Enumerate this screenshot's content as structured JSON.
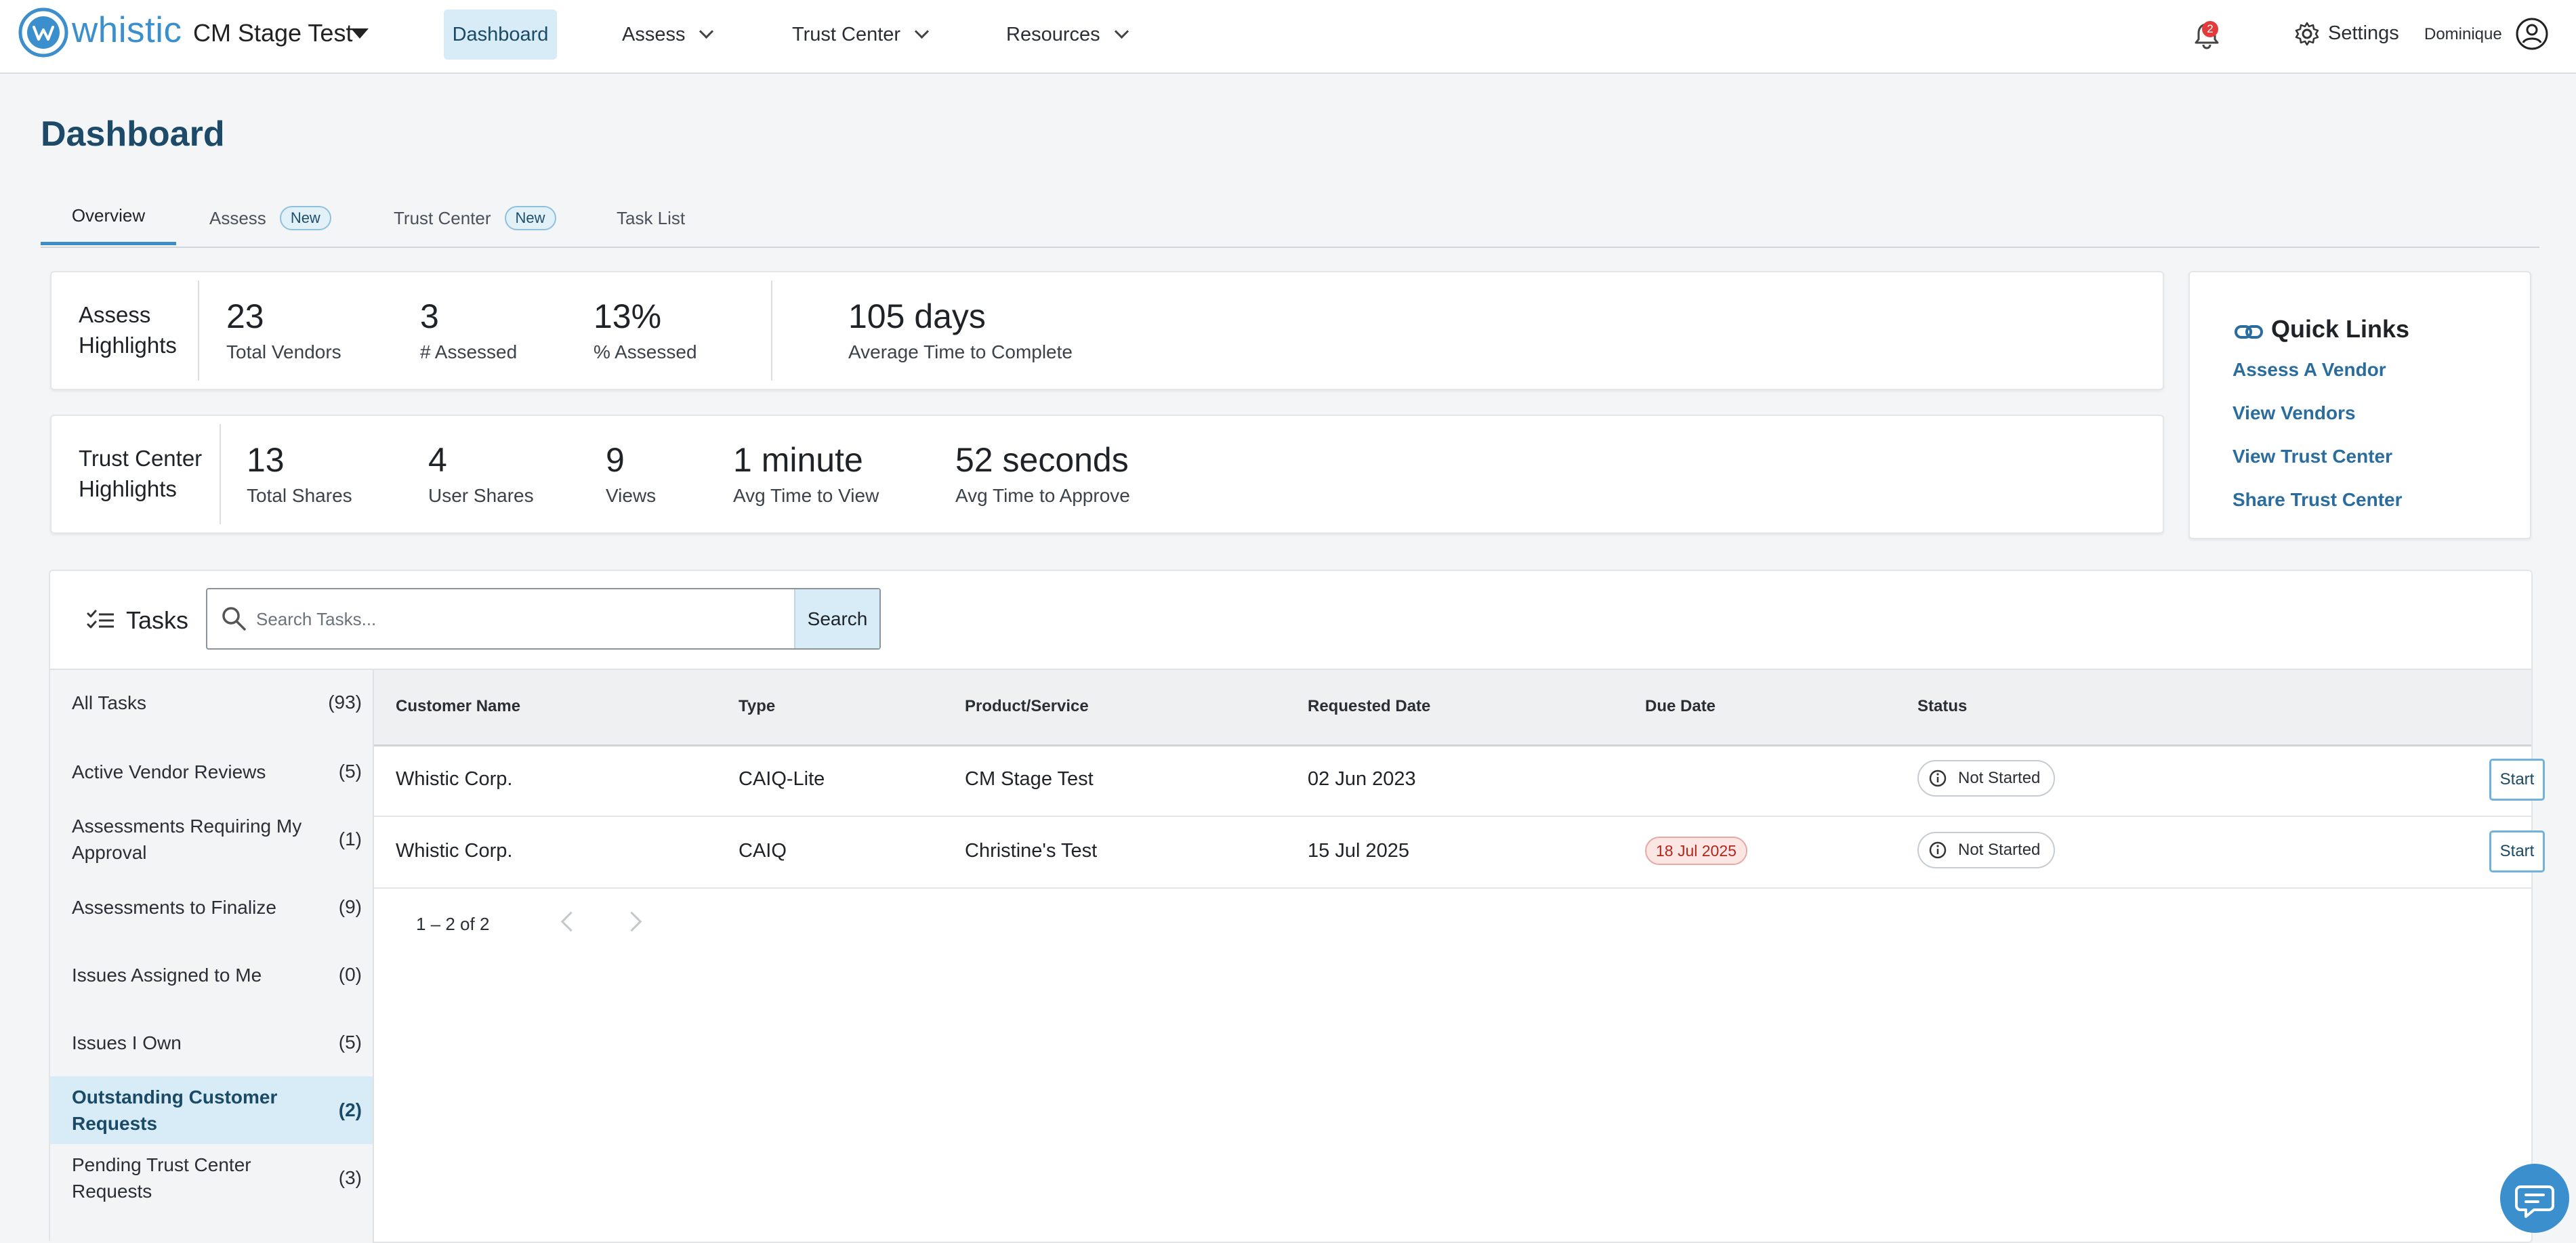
{
  "header": {
    "logo_text": "whistic",
    "org_name": "CM Stage Test",
    "nav": [
      {
        "label": "Dashboard",
        "active": true
      },
      {
        "label": "Assess"
      },
      {
        "label": "Trust Center"
      },
      {
        "label": "Resources"
      }
    ],
    "notification_count": "2",
    "settings_label": "Settings",
    "user_name": "Dominique"
  },
  "page": {
    "title": "Dashboard",
    "tabs": [
      {
        "label": "Overview",
        "active": true
      },
      {
        "label": "Assess",
        "badge": "New"
      },
      {
        "label": "Trust Center",
        "badge": "New"
      },
      {
        "label": "Task List"
      }
    ]
  },
  "assess_highlights": {
    "label_line1": "Assess",
    "label_line2": "Highlights",
    "stats": [
      {
        "value": "23",
        "label": "Total Vendors"
      },
      {
        "value": "3",
        "label": "# Assessed"
      },
      {
        "value": "13%",
        "label": "% Assessed"
      },
      {
        "value": "105 days",
        "label": "Average Time to Complete"
      }
    ]
  },
  "trust_highlights": {
    "label_line1": "Trust Center",
    "label_line2": "Highlights",
    "stats": [
      {
        "value": "13",
        "label": "Total Shares"
      },
      {
        "value": "4",
        "label": "User Shares"
      },
      {
        "value": "9",
        "label": "Views"
      },
      {
        "value": "1 minute",
        "label": "Avg Time to View"
      },
      {
        "value": "52 seconds",
        "label": "Avg Time to Approve"
      }
    ]
  },
  "quick_links": {
    "title": "Quick Links",
    "links": [
      "Assess A Vendor",
      "View Vendors",
      "View Trust Center",
      "Share Trust Center"
    ]
  },
  "tasks": {
    "title": "Tasks",
    "search_placeholder": "Search Tasks...",
    "search_button": "Search",
    "sidebar": [
      {
        "label": "All Tasks",
        "count": "(93)"
      },
      {
        "label": "Active Vendor Reviews",
        "count": "(5)"
      },
      {
        "label": "Assessments Requiring My Approval",
        "count": "(1)"
      },
      {
        "label": "Assessments to Finalize",
        "count": "(9)"
      },
      {
        "label": "Issues Assigned to Me",
        "count": "(0)"
      },
      {
        "label": "Issues I Own",
        "count": "(5)"
      },
      {
        "label": "Outstanding Customer Requests",
        "count": "(2)",
        "active": true
      },
      {
        "label": "Pending Trust Center Requests",
        "count": "(3)"
      }
    ],
    "columns": [
      "Customer Name",
      "Type",
      "Product/Service",
      "Requested Date",
      "Due Date",
      "Status"
    ],
    "rows": [
      {
        "customer": "Whistic Corp.",
        "type": "CAIQ-Lite",
        "product": "CM Stage Test",
        "requested": "02 Jun 2023",
        "due": "",
        "status": "Not Started",
        "action": "Start"
      },
      {
        "customer": "Whistic Corp.",
        "type": "CAIQ",
        "product": "Christine's Test",
        "requested": "15 Jul 2025",
        "due": "18 Jul 2025",
        "status": "Not Started",
        "action": "Start"
      }
    ],
    "pagination": "1 – 2 of 2"
  },
  "colors": {
    "brand": "#3a8fcc",
    "active_bg": "#d7ecf6",
    "title_text": "#1c4a68",
    "link": "#2b6c9e",
    "due_badge": "#b3261e",
    "notification": "#e23b3b"
  }
}
